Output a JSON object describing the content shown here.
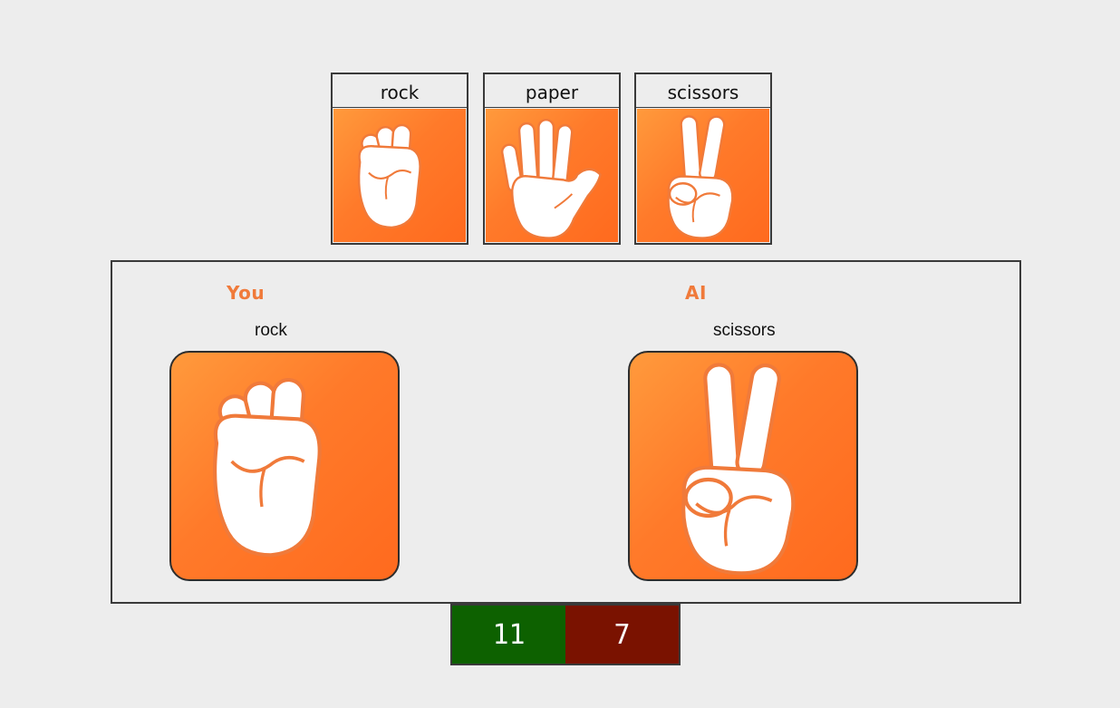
{
  "choices": [
    {
      "label": "rock",
      "icon": "rock-fist-icon"
    },
    {
      "label": "paper",
      "icon": "paper-hand-icon"
    },
    {
      "label": "scissors",
      "icon": "scissors-hand-icon"
    }
  ],
  "arena": {
    "you": {
      "title": "You",
      "pick": "rock",
      "icon": "rock-fist-icon"
    },
    "ai": {
      "title": "AI",
      "pick": "scissors",
      "icon": "scissors-hand-icon"
    }
  },
  "score": {
    "you": "11",
    "ai": "7"
  },
  "colors": {
    "accent": "#f07a3a",
    "card_orange": "#ff7a2a",
    "win": "#0d6100",
    "loss": "#7a1200",
    "background": "#ededed"
  }
}
